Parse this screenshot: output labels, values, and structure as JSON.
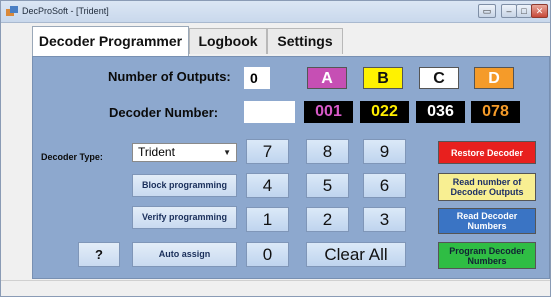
{
  "window": {
    "title": "DecProSoft - [Trident]"
  },
  "tabs": {
    "decoder_programmer": "Decoder Programmer",
    "logbook": "Logbook",
    "settings": "Settings"
  },
  "labels": {
    "number_of_outputs": "Number of Outputs:",
    "decoder_number": "Decoder Number:",
    "decoder_type": "Decoder Type:"
  },
  "values": {
    "number_of_outputs": "0",
    "decoder_number_input": "",
    "decoder_type_selected": "Trident"
  },
  "outputs": [
    {
      "letter": "A",
      "number": "001",
      "color": "#c64fb4"
    },
    {
      "letter": "B",
      "number": "022",
      "color": "#fff200"
    },
    {
      "letter": "C",
      "number": "036",
      "color": "#ffffff"
    },
    {
      "letter": "D",
      "number": "078",
      "color": "#f59b29"
    }
  ],
  "keypad": {
    "k7": "7",
    "k8": "8",
    "k9": "9",
    "k4": "4",
    "k5": "5",
    "k6": "6",
    "k1": "1",
    "k2": "2",
    "k3": "3",
    "k0": "0",
    "clear": "Clear All"
  },
  "buttons": {
    "block_programming": "Block programming",
    "verify_programming": "Verify programming",
    "auto_assign": "Auto assign",
    "help": "?",
    "restore_decoder": "Restore Decoder",
    "read_outputs": "Read number of Decoder Outputs",
    "read_numbers": "Read Decoder Numbers",
    "program_numbers": "Program Decoder Numbers"
  },
  "icons": {
    "app": "app-icon",
    "dropdown": "chevron-down-icon"
  },
  "colors": {
    "panel": "#8da8ce",
    "restore": "#e8201e",
    "read_outputs": "#f8ef92",
    "read_numbers": "#3a74c4",
    "program": "#2fbd44"
  }
}
